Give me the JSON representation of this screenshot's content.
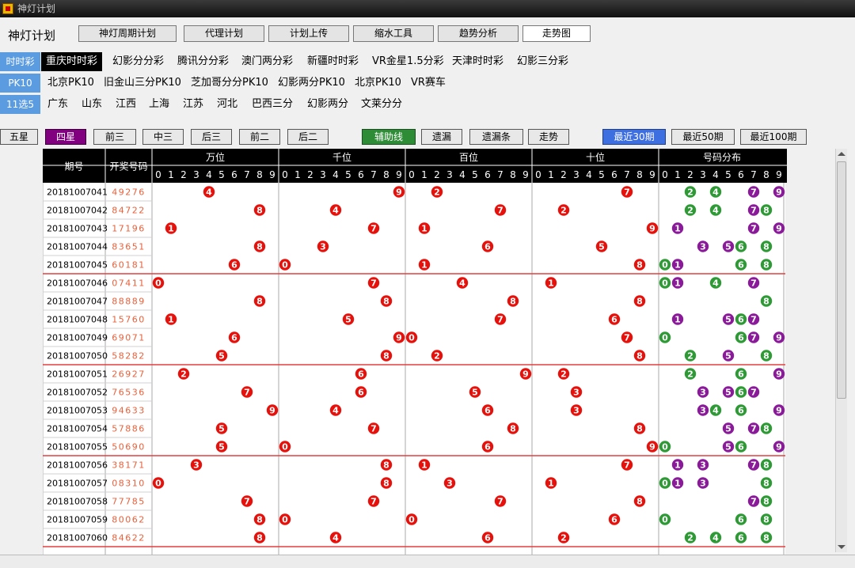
{
  "window": {
    "title": "神灯计划"
  },
  "app": {
    "name": "神灯计划"
  },
  "toolbar": [
    "神灯周期计划",
    "代理计划",
    "计划上传",
    "缩水工具",
    "趋势分析",
    "走势图"
  ],
  "categories": [
    {
      "label": "时时彩",
      "items": [
        "重庆时时彩",
        "幻影分分彩",
        "腾讯分分彩",
        "澳门两分彩",
        "新疆时时彩",
        "VR金星1.5分彩",
        "天津时时彩",
        "幻影三分彩"
      ],
      "selected": 0
    },
    {
      "label": "PK10",
      "items": [
        "北京PK10",
        "旧金山三分PK10",
        "芝加哥分分PK10",
        "幻影两分PK10",
        "北京PK10",
        "VR赛车"
      ],
      "selected": -1
    },
    {
      "label": "11选5",
      "items": [
        "广东",
        "山东",
        "江西",
        "上海",
        "江苏",
        "河北",
        "巴西三分",
        "幻影两分",
        "文莱分分"
      ],
      "selected": -1
    }
  ],
  "filters": {
    "positions": [
      "五星",
      "四星",
      "前三",
      "中三",
      "后三",
      "前二",
      "后二"
    ],
    "positions_selected": "四星",
    "tools": [
      "辅助线",
      "遗漏",
      "遗漏条",
      "走势"
    ],
    "periods": [
      "最近30期",
      "最近50期",
      "最近100期"
    ],
    "periods_selected": "最近30期"
  },
  "table": {
    "col_issue": "期号",
    "col_numbers": "开奖号码",
    "positions": [
      "万位",
      "千位",
      "百位",
      "十位"
    ],
    "distribution": "号码分布",
    "digits": [
      "0",
      "1",
      "2",
      "3",
      "4",
      "5",
      "6",
      "7",
      "8",
      "9"
    ],
    "rows": [
      {
        "issue": "20181007041",
        "numbers": "49276"
      },
      {
        "issue": "20181007042",
        "numbers": "84722"
      },
      {
        "issue": "20181007043",
        "numbers": "17196"
      },
      {
        "issue": "20181007044",
        "numbers": "83651"
      },
      {
        "issue": "20181007045",
        "numbers": "60181"
      },
      {
        "issue": "20181007046",
        "numbers": "07411"
      },
      {
        "issue": "20181007047",
        "numbers": "88889"
      },
      {
        "issue": "20181007048",
        "numbers": "15760"
      },
      {
        "issue": "20181007049",
        "numbers": "69071"
      },
      {
        "issue": "20181007050",
        "numbers": "58282"
      },
      {
        "issue": "20181007051",
        "numbers": "26927"
      },
      {
        "issue": "20181007052",
        "numbers": "76536"
      },
      {
        "issue": "20181007053",
        "numbers": "94633"
      },
      {
        "issue": "20181007054",
        "numbers": "57886"
      },
      {
        "issue": "20181007055",
        "numbers": "50690"
      },
      {
        "issue": "20181007056",
        "numbers": "38171"
      },
      {
        "issue": "20181007057",
        "numbers": "08310"
      },
      {
        "issue": "20181007058",
        "numbers": "77785"
      },
      {
        "issue": "20181007059",
        "numbers": "80062"
      },
      {
        "issue": "20181007060",
        "numbers": "84622"
      }
    ]
  },
  "colors": {
    "red": "#e8100a",
    "green": "#2e9a35",
    "purple": "#8a1a9a",
    "blue": "#3d6fe0",
    "header_bg": "#000000",
    "sep_line": "#e04040"
  }
}
